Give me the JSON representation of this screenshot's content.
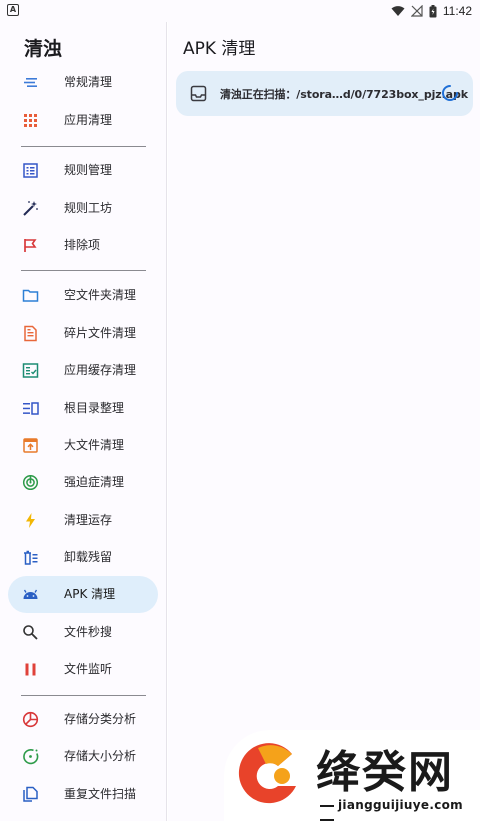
{
  "status_bar": {
    "left_badge": "A",
    "time": "11:42"
  },
  "drawer": {
    "title": "清浊",
    "items": [
      {
        "label": "常规清理",
        "icon": "lines-icon",
        "color": "#3d7bd8"
      },
      {
        "label": "应用清理",
        "icon": "grid-dots-icon",
        "color": "#e85d3a"
      },
      {
        "label": "规则管理",
        "icon": "list-box-icon",
        "color": "#3556c7"
      },
      {
        "label": "规则工坊",
        "icon": "magic-wand-icon",
        "color": "#222a55"
      },
      {
        "label": "排除项",
        "icon": "flag-icon",
        "color": "#d8383a"
      },
      {
        "label": "空文件夹清理",
        "icon": "folder-icon",
        "color": "#2d7fd6"
      },
      {
        "label": "碎片文件清理",
        "icon": "document-icon",
        "color": "#e8673a"
      },
      {
        "label": "应用缓存清理",
        "icon": "checklist-icon",
        "color": "#1d8c73"
      },
      {
        "label": "根目录整理",
        "icon": "columns-icon",
        "color": "#3556c7"
      },
      {
        "label": "大文件清理",
        "icon": "archive-icon",
        "color": "#e87a2a"
      },
      {
        "label": "强迫症清理",
        "icon": "radar-icon",
        "color": "#2e9b4a"
      },
      {
        "label": "清理运存",
        "icon": "lightning-icon",
        "color": "#f2b705"
      },
      {
        "label": "卸载残留",
        "icon": "uninstall-icon",
        "color": "#2a5fc4"
      },
      {
        "label": "APK 清理",
        "icon": "android-icon",
        "color": "#2a5fc4"
      },
      {
        "label": "文件秒搜",
        "icon": "search-icon",
        "color": "#333333"
      },
      {
        "label": "文件监听",
        "icon": "pause-icon",
        "color": "#e0413a"
      },
      {
        "label": "存储分类分析",
        "icon": "pie-icon",
        "color": "#d8383a"
      },
      {
        "label": "存储大小分析",
        "icon": "dial-icon",
        "color": "#2e9b4a"
      },
      {
        "label": "重复文件扫描",
        "icon": "copy-icon",
        "color": "#2a5fc4"
      }
    ],
    "active_index": 13
  },
  "main": {
    "title": "APK 清理",
    "scan_status": "清浊正在扫描：/stora…d/0/7723box_pjz.apk"
  },
  "watermark": {
    "brand": "绛癸网",
    "url": "jiangguijiuye.com"
  },
  "colors": {
    "accent": "#1f6fd6",
    "active_bg": "#dfeefb",
    "card_bg": "#e2eef9"
  }
}
